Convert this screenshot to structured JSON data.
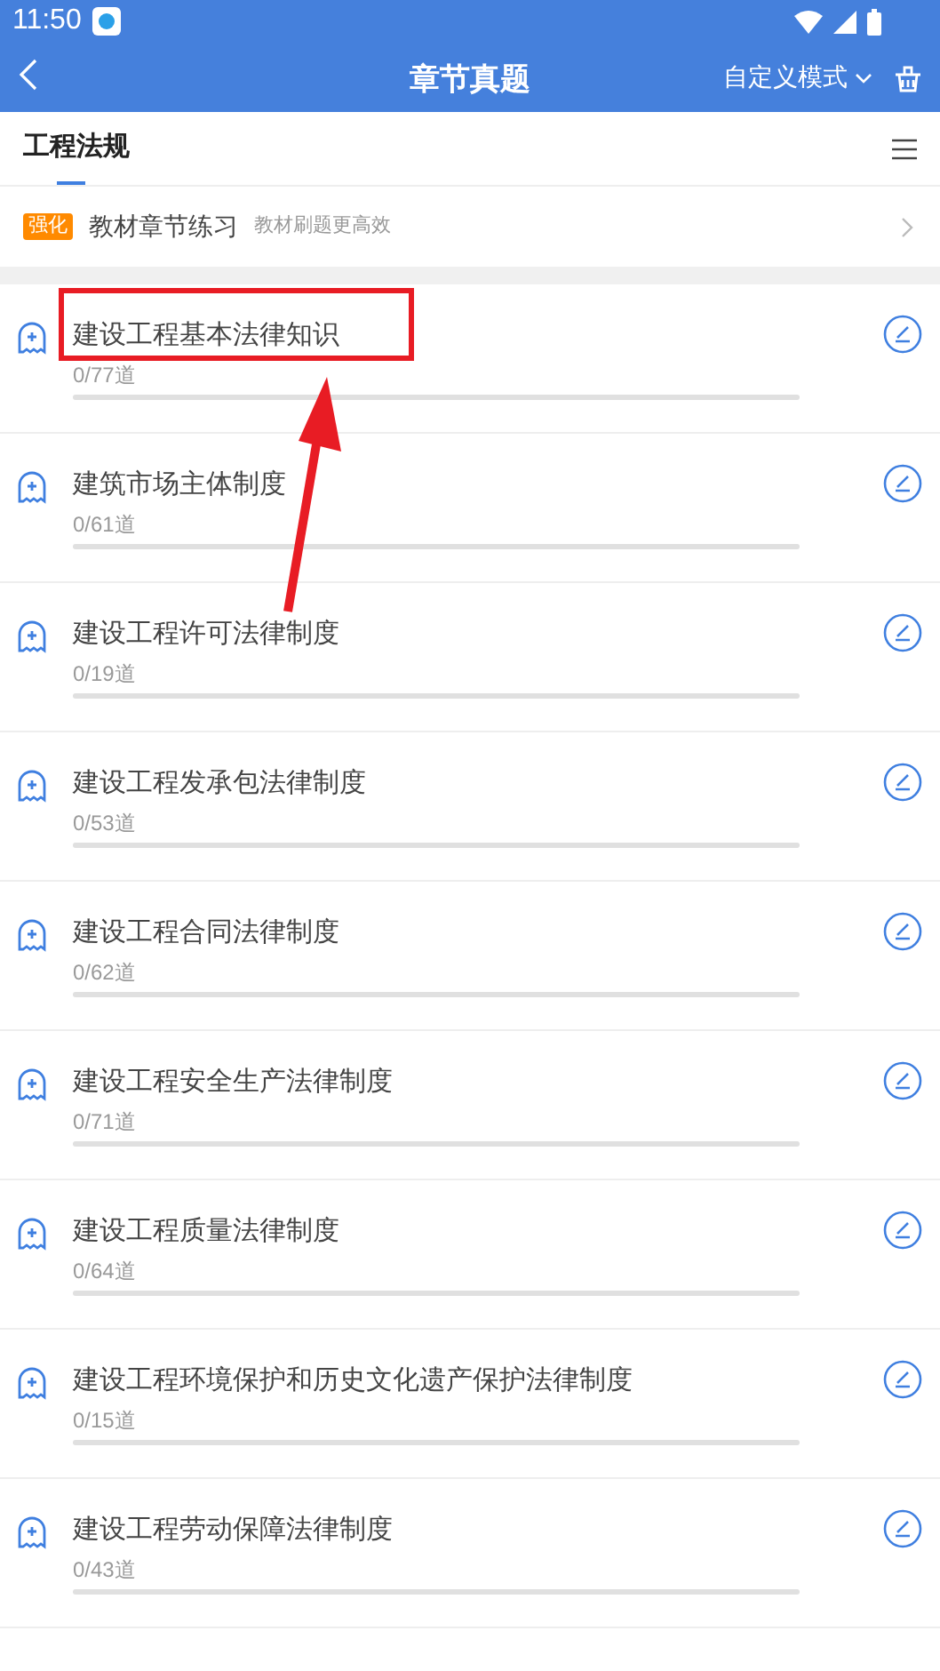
{
  "status_bar": {
    "time": "11:50"
  },
  "header": {
    "title": "章节真题",
    "mode": "自定义模式"
  },
  "tabs": [
    {
      "label": "工程法规",
      "selected": true
    }
  ],
  "promo": {
    "badge": "强化",
    "title": "教材章节练习",
    "subtitle": "教材刷题更高效"
  },
  "chapters": [
    {
      "title": "建设工程基本法律知识",
      "count": "0/77道",
      "level": 0
    },
    {
      "title": "建筑市场主体制度",
      "count": "0/61道",
      "level": 0
    },
    {
      "title": "建设工程许可法律制度",
      "count": "0/19道",
      "level": 0
    },
    {
      "title": "建设工程发承包法律制度",
      "count": "0/53道",
      "level": 0
    },
    {
      "title": "建设工程合同法律制度",
      "count": "0/62道",
      "level": 0
    },
    {
      "title": "建设工程安全生产法律制度",
      "count": "0/71道",
      "level": 0
    },
    {
      "title": "建设工程质量法律制度",
      "count": "0/64道",
      "level": 0
    },
    {
      "title": "建设工程环境保护和历史文化遗产保护法律制度",
      "count": "0/15道",
      "level": 0
    },
    {
      "title": "建设工程劳动保障法律制度",
      "count": "0/43道",
      "level": 0
    }
  ]
}
